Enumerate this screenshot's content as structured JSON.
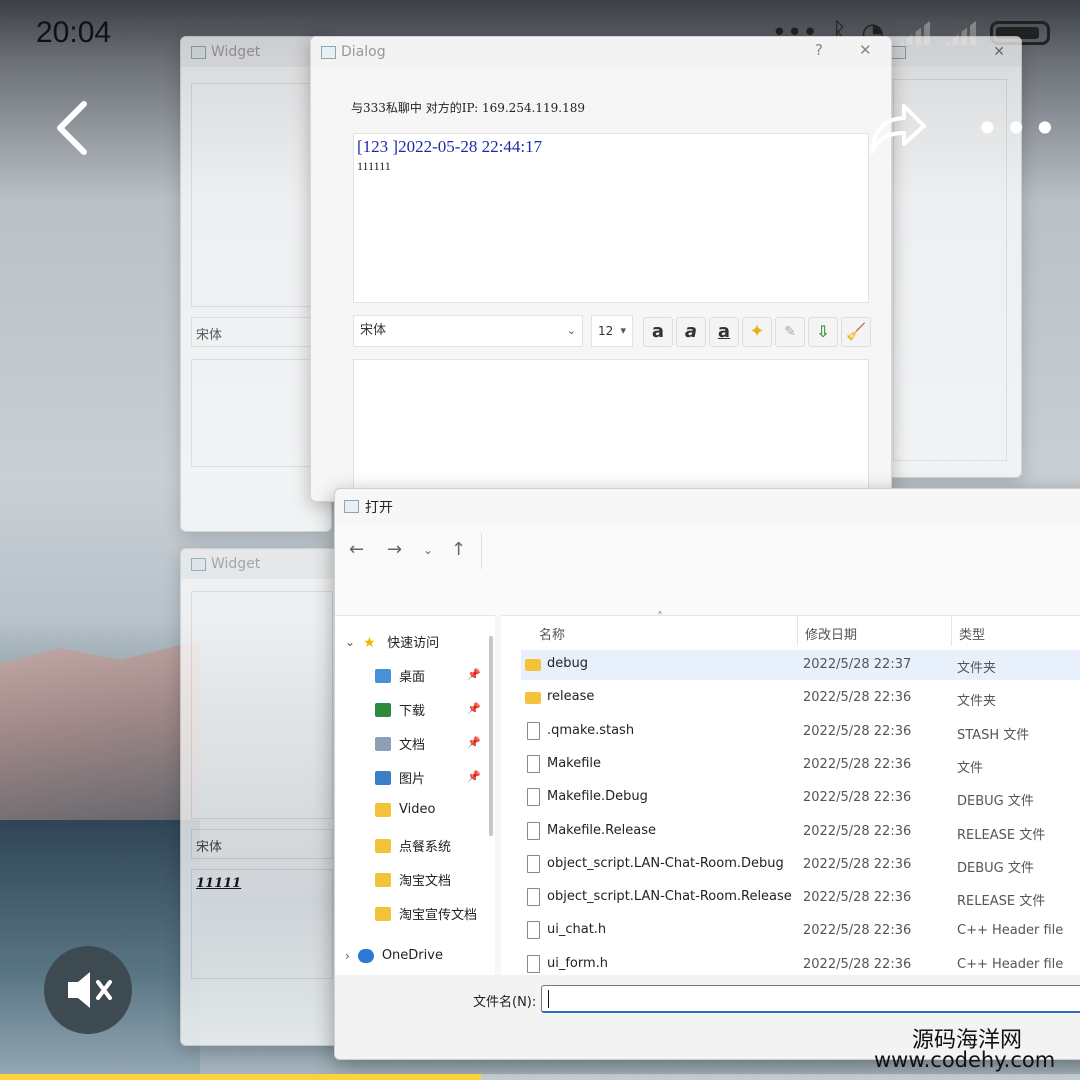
{
  "status_bar": {
    "time": "20:04",
    "more": "•••"
  },
  "nav": {
    "more": "•••"
  },
  "widget_top": {
    "title": "Widget",
    "font": "宋体"
  },
  "dialog": {
    "title": "Dialog",
    "info": "与333私聊中 对方的IP: 169.254.119.189",
    "message_header": "[123 ]2022-05-28 22:44:17",
    "message_body": "111111",
    "font_combo": "宋体",
    "size_combo": "12",
    "toolbar_icons": [
      "bold-icon",
      "italic-icon",
      "underline-icon",
      "color-icon",
      "save-icon",
      "load-icon",
      "clear-icon"
    ]
  },
  "widget_bottom": {
    "title": "Widget",
    "font": "宋体",
    "input_text": "11111"
  },
  "explorer": {
    "title": "打开",
    "columns": [
      "名称",
      "修改日期",
      "类型"
    ],
    "sidebar": [
      {
        "label": "快速访问",
        "icon": "star-icon"
      },
      {
        "label": "桌面",
        "icon": "desktop-icon",
        "pinned": true
      },
      {
        "label": "下载",
        "icon": "download-icon",
        "pinned": true
      },
      {
        "label": "文档",
        "icon": "document-icon",
        "pinned": true
      },
      {
        "label": "图片",
        "icon": "picture-icon",
        "pinned": true
      },
      {
        "label": "Video",
        "icon": "folder-icon"
      },
      {
        "label": "点餐系统",
        "icon": "folder-icon"
      },
      {
        "label": "淘宝文档",
        "icon": "folder-icon"
      },
      {
        "label": "淘宝宣传文档",
        "icon": "folder-icon"
      },
      {
        "label": "OneDrive",
        "icon": "cloud-icon"
      }
    ],
    "files": [
      {
        "name": "debug",
        "date": "2022/5/28 22:37",
        "type": "文件夹",
        "kind": "folder"
      },
      {
        "name": "release",
        "date": "2022/5/28 22:36",
        "type": "文件夹",
        "kind": "folder"
      },
      {
        "name": ".qmake.stash",
        "date": "2022/5/28 22:36",
        "type": "STASH 文件",
        "kind": "file"
      },
      {
        "name": "Makefile",
        "date": "2022/5/28 22:36",
        "type": "文件",
        "kind": "file"
      },
      {
        "name": "Makefile.Debug",
        "date": "2022/5/28 22:36",
        "type": "DEBUG 文件",
        "kind": "file"
      },
      {
        "name": "Makefile.Release",
        "date": "2022/5/28 22:36",
        "type": "RELEASE 文件",
        "kind": "file"
      },
      {
        "name": "object_script.LAN-Chat-Room.Debug",
        "date": "2022/5/28 22:36",
        "type": "DEBUG 文件",
        "kind": "file"
      },
      {
        "name": "object_script.LAN-Chat-Room.Release",
        "date": "2022/5/28 22:36",
        "type": "RELEASE 文件",
        "kind": "file"
      },
      {
        "name": "ui_chat.h",
        "date": "2022/5/28 22:36",
        "type": "C++ Header file",
        "kind": "file"
      },
      {
        "name": "ui_form.h",
        "date": "2022/5/28 22:36",
        "type": "C++ Header file",
        "kind": "file"
      }
    ],
    "filename_label": "文件名(N):",
    "filename_value": ""
  },
  "watermark": {
    "line1": "源码海洋网",
    "line2": "www.codehy.com"
  },
  "video_progress": 0.445,
  "colors": {
    "accent": "#2b6cc4",
    "message_header": "#1d2aa8",
    "progress": "#ffd23a"
  }
}
